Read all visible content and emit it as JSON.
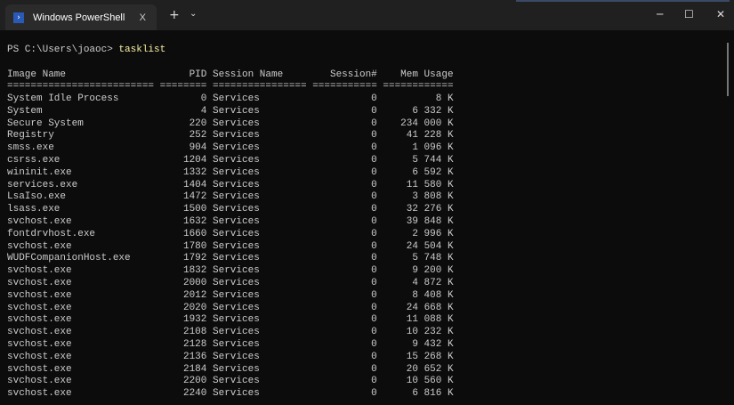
{
  "window": {
    "tab_title": "Windows PowerShell",
    "tab_close": "X",
    "new_tab": "+",
    "dropdown": "⌄",
    "minimize": "─",
    "maximize": "☐",
    "close": "✕"
  },
  "terminal": {
    "prompt": "PS C:\\Users\\joaoc> ",
    "command": "tasklist",
    "headers": [
      "Image Name",
      "PID",
      "Session Name",
      "Session#",
      "Mem Usage"
    ],
    "separators": [
      "=========================",
      "========",
      "================",
      "===========",
      "============"
    ],
    "rows": [
      [
        "System Idle Process",
        "0",
        "Services",
        "0",
        "8 K"
      ],
      [
        "System",
        "4",
        "Services",
        "0",
        "6 332 K"
      ],
      [
        "Secure System",
        "220",
        "Services",
        "0",
        "234 000 K"
      ],
      [
        "Registry",
        "252",
        "Services",
        "0",
        "41 228 K"
      ],
      [
        "smss.exe",
        "904",
        "Services",
        "0",
        "1 096 K"
      ],
      [
        "csrss.exe",
        "1204",
        "Services",
        "0",
        "5 744 K"
      ],
      [
        "wininit.exe",
        "1332",
        "Services",
        "0",
        "6 592 K"
      ],
      [
        "services.exe",
        "1404",
        "Services",
        "0",
        "11 580 K"
      ],
      [
        "LsaIso.exe",
        "1472",
        "Services",
        "0",
        "3 808 K"
      ],
      [
        "lsass.exe",
        "1500",
        "Services",
        "0",
        "32 276 K"
      ],
      [
        "svchost.exe",
        "1632",
        "Services",
        "0",
        "39 848 K"
      ],
      [
        "fontdrvhost.exe",
        "1660",
        "Services",
        "0",
        "2 996 K"
      ],
      [
        "svchost.exe",
        "1780",
        "Services",
        "0",
        "24 504 K"
      ],
      [
        "WUDFCompanionHost.exe",
        "1792",
        "Services",
        "0",
        "5 748 K"
      ],
      [
        "svchost.exe",
        "1832",
        "Services",
        "0",
        "9 200 K"
      ],
      [
        "svchost.exe",
        "2000",
        "Services",
        "0",
        "4 872 K"
      ],
      [
        "svchost.exe",
        "2012",
        "Services",
        "0",
        "8 408 K"
      ],
      [
        "svchost.exe",
        "2020",
        "Services",
        "0",
        "24 668 K"
      ],
      [
        "svchost.exe",
        "1932",
        "Services",
        "0",
        "11 088 K"
      ],
      [
        "svchost.exe",
        "2108",
        "Services",
        "0",
        "10 232 K"
      ],
      [
        "svchost.exe",
        "2128",
        "Services",
        "0",
        "9 432 K"
      ],
      [
        "svchost.exe",
        "2136",
        "Services",
        "0",
        "15 268 K"
      ],
      [
        "svchost.exe",
        "2184",
        "Services",
        "0",
        "20 652 K"
      ],
      [
        "svchost.exe",
        "2200",
        "Services",
        "0",
        "10 560 K"
      ],
      [
        "svchost.exe",
        "2240",
        "Services",
        "0",
        "6 816 K"
      ]
    ]
  }
}
